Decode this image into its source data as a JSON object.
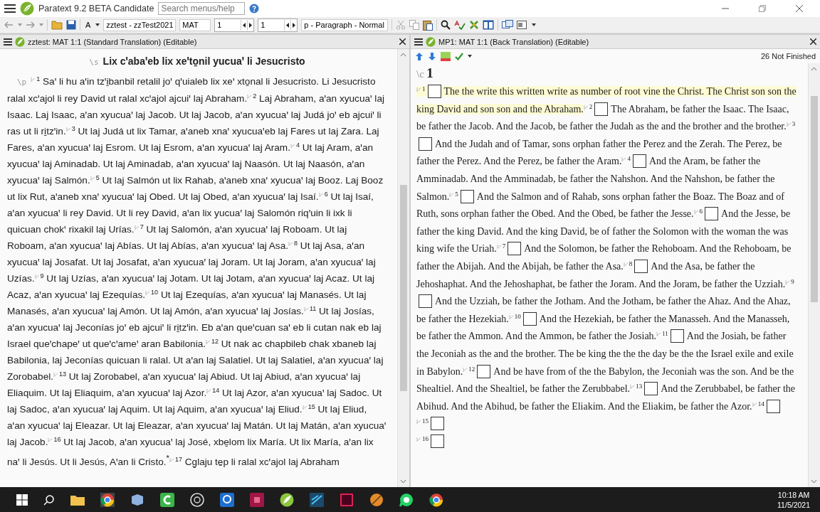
{
  "window": {
    "title": "Paratext 9.2 BETA Candidate"
  },
  "search": {
    "placeholder": "Search menus/help"
  },
  "toolbar": {
    "font_button": "A",
    "project": "zztest - zzTest2021",
    "book": "MAT",
    "chapter": "1",
    "verse": "1",
    "style": "p - Paragraph - Normal"
  },
  "standard_pane": {
    "title": "zztest: MAT 1:1 (Standard Translation) (Editable)",
    "heading_marker": "\\s",
    "heading": "Lix cꞌabaꞌeb lix xeꞌto̱nil yucuaꞌ li Jesucristo",
    "paragraph_marker": "\\p",
    "verses": [
      {
        "number": "1",
        "text": "Saꞌ li hu aꞌin tzꞌi̱banbil retalil joꞌ qꞌuialeb lix xeꞌ xto̱nal li Jesucristo. Li Jesucristo ralal xcꞌajol li rey David ut ralal xcꞌajol ajcuiꞌ laj Abraham."
      },
      {
        "number": "2",
        "text": "Laj Abraham, aꞌan xyucuaꞌ laj Isaac. Laj Isaac, aꞌan xyucuaꞌ laj Jacob. Ut laj Jacob, aꞌan xyucuaꞌ laj Judá joꞌ eb ajcuiꞌ li ras ut li ri̱tzꞌin."
      },
      {
        "number": "3",
        "text": "Ut laj Judá ut lix Tamar, aꞌaneb xnaꞌ xyucuaꞌeb laj Fares ut laj Zara. Laj Fares, aꞌan xyucuaꞌ laj Esrom. Ut laj Esrom, aꞌan xyucuaꞌ laj Aram."
      },
      {
        "number": "4",
        "text": "Ut laj Aram, aꞌan xyucuaꞌ laj Aminadab. Ut laj Aminadab, aꞌan xyucuaꞌ laj Naasón. Ut laj Naasón, aꞌan xyucuaꞌ laj Salmón."
      },
      {
        "number": "5",
        "text": "Ut laj Salmón ut lix Rahab, aꞌaneb xnaꞌ xyucuaꞌ laj Booz. Laj Booz ut lix Rut, aꞌaneb xnaꞌ xyucuaꞌ laj Obed. Ut laj Obed, aꞌan xyucuaꞌ laj Isaí."
      },
      {
        "number": "6",
        "text": "Ut laj Isaí, aꞌan xyucuaꞌ li rey David. Ut li rey David, aꞌan lix yucuaꞌ laj Salomón riqꞌuin li ixk li quicuan chokꞌ rixakil laj Urías."
      },
      {
        "number": "7",
        "text": "Ut laj Salomón, aꞌan xyucuaꞌ laj Roboam. Ut laj Roboam, aꞌan xyucuaꞌ laj Abías. Ut laj Abías, aꞌan xyucuaꞌ laj Asa."
      },
      {
        "number": "8",
        "text": "Ut laj Asa, aꞌan xyucuaꞌ laj Josafat. Ut laj Josafat, aꞌan xyucuaꞌ laj Joram. Ut laj Joram, aꞌan xyucuaꞌ laj Uzías."
      },
      {
        "number": "9",
        "text": "Ut laj Uzías, aꞌan xyucuaꞌ laj Jotam. Ut laj Jotam, aꞌan xyucuaꞌ laj Acaz. Ut laj Acaz, aꞌan xyucuaꞌ laj Ezequías."
      },
      {
        "number": "10",
        "text": "Ut laj Ezequías, aꞌan xyucuaꞌ laj Manasés. Ut laj Manasés, aꞌan xyucuaꞌ laj Amón. Ut laj Amón, aꞌan xyucuaꞌ laj Josías."
      },
      {
        "number": "11",
        "text": "Ut laj Josías, aꞌan xyucuaꞌ laj Jeconías joꞌ eb ajcuiꞌ li ri̱tzꞌin. Eb aꞌan queꞌcuan saꞌ eb li cutan nak eb laj Israel queꞌchapeꞌ ut queꞌcꞌameꞌ aran Babilonia."
      },
      {
        "number": "12",
        "text": "Ut nak ac chapbileb chak xbaneb laj Babilonia, laj Jeconías quicuan li ralal. Ut aꞌan laj Salatiel. Ut laj Salatiel, aꞌan xyucuaꞌ laj Zorobabel."
      },
      {
        "number": "13",
        "text": "Ut laj Zorobabel, aꞌan xyucuaꞌ laj Abiud. Ut laj Abiud, aꞌan xyucuaꞌ laj Eliaquim. Ut laj Eliaquim, aꞌan xyucuaꞌ laj Azor."
      },
      {
        "number": "14",
        "text": "Ut laj Azor, aꞌan xyucuaꞌ laj Sadoc. Ut laj Sadoc, aꞌan xyucuaꞌ laj Aquim. Ut laj Aquim, aꞌan xyucuaꞌ laj Eliud."
      },
      {
        "number": "15",
        "text": "Ut laj Eliud, aꞌan xyucuaꞌ laj Eleazar. Ut laj Eleazar, aꞌan xyucuaꞌ laj Matán. Ut laj Matán, aꞌan xyucuaꞌ laj Jacob."
      },
      {
        "number": "16",
        "text": "Ut laj Jacob, aꞌan xyucuaꞌ laj José, xbe̱lom lix María. Ut lix María, aꞌan lix naꞌ li Jesús. Ut li Jesús, Aꞌan li Cristo.$^{*}$"
      },
      {
        "number": "17",
        "text": "Cg̱laju te̱p li ralal xcꞌajol laj Abraham"
      }
    ]
  },
  "back_translation_pane": {
    "title": "MP1: MAT 1:1 (Back Translation) (Editable)",
    "status": "26 Not Finished",
    "chapter_marker": "\\c",
    "chapter": "1",
    "verses": [
      {
        "number": "1",
        "selected": true,
        "text": "The the write this written write as number of root vine the Christ. The Christ son son the king David and son son and the Abraham."
      },
      {
        "number": "2",
        "selected": false,
        "text": "The Abraham, be father the Isaac. The Isaac, be father the Jacob. And the Jacob, be father the Judah as the and the brother and the brother."
      },
      {
        "number": "3",
        "selected": false,
        "text": "And the Judah and of Tamar, sons orphan father the Perez and the Zerah. The Perez, be father the Perez. And the Perez, be father the Aram."
      },
      {
        "number": "4",
        "selected": false,
        "text": "And the Aram, be father the Amminadab. And the Amminadab, be father the Nahshon. And the Nahshon, be father the Salmon."
      },
      {
        "number": "5",
        "selected": false,
        "text": "And the Salmon and of Rahab, sons orphan father the Boaz. The Boaz and of Ruth, sons orphan father the Obed. And the Obed, be father the Jesse."
      },
      {
        "number": "6",
        "selected": false,
        "text": "And the Jesse, be father the king David. And the king David, be of father the Solomon with the woman the was king wife the Uriah."
      },
      {
        "number": "7",
        "selected": false,
        "text": "And the Solomon, be father the Rehoboam. And the Rehoboam, be father the Abijah. And the Abijah, be father the Asa."
      },
      {
        "number": "8",
        "selected": false,
        "text": "And the Asa, be father the Jehoshaphat. And the Jehoshaphat, be father the Joram. And the Joram, be father the Uzziah."
      },
      {
        "number": "9",
        "selected": false,
        "text": "And the Uzziah, be father the Jotham. And the Jotham, be father the Ahaz. And the Ahaz, be father the Hezekiah."
      },
      {
        "number": "10",
        "selected": false,
        "text": "And the Hezekiah, be father the Manasseh. And the Manasseh, be father the Ammon. And the Ammon, be father the Josiah."
      },
      {
        "number": "11",
        "selected": false,
        "text": "And the Josiah, be father the Jeconiah as the and the brother. The be king the the the day be the the Israel exile and exile in Babylon."
      },
      {
        "number": "12",
        "selected": false,
        "text": "And be have from of the the Babylon, the Jeconiah was the son. And be the Shealtiel. And the Shealtiel, be father the Zerubbabel."
      },
      {
        "number": "13",
        "selected": false,
        "text": "And the Zerubbabel, be father the Abihud. And the Abihud, be father the Eliakim. And the Eliakim, be father the Azor."
      },
      {
        "number": "14",
        "selected": false
      },
      {
        "number": "15",
        "selected": false
      },
      {
        "number": "16",
        "selected": false
      }
    ]
  },
  "taskbar": {
    "time": "10:18 AM",
    "date": "11/5/2021"
  }
}
